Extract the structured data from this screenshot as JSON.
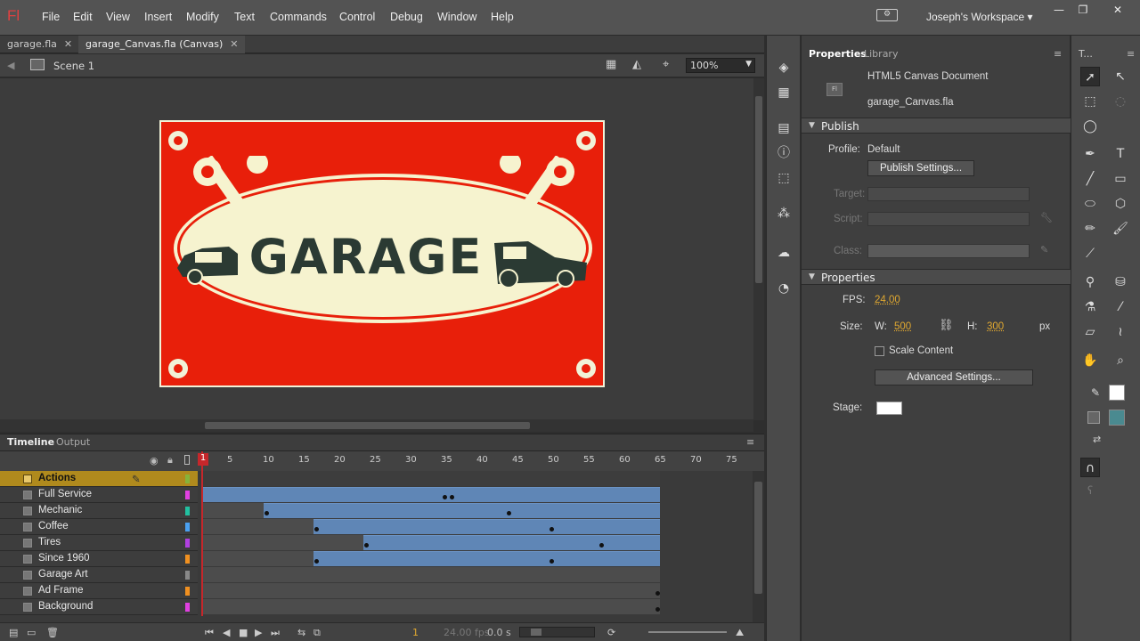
{
  "app": {
    "logo": "Fl"
  },
  "menu": [
    "File",
    "Edit",
    "View",
    "Insert",
    "Modify",
    "Text",
    "Commands",
    "Control",
    "Debug",
    "Window",
    "Help"
  ],
  "workspace": {
    "label": "Joseph's Workspace ▾"
  },
  "window": {
    "minimize": "—",
    "restore": "❐",
    "close": "✕"
  },
  "doc_tabs": [
    {
      "label": "garage.fla",
      "close": "✕"
    },
    {
      "label": "garage_Canvas.fla (Canvas)",
      "close": "✕"
    }
  ],
  "edit_bar": {
    "scene": "Scene 1",
    "zoom": "100%"
  },
  "stage_art": {
    "headline": "GARAGE"
  },
  "timeline": {
    "tabs": [
      "Timeline",
      "Output"
    ],
    "ticks": [
      "1",
      "5",
      "10",
      "15",
      "20",
      "25",
      "30",
      "35",
      "40",
      "45",
      "50",
      "55",
      "60",
      "65",
      "70",
      "75"
    ],
    "playhead": "1",
    "layers": [
      {
        "name": "Actions",
        "color": "#b07a2c"
      },
      {
        "name": "Full Service",
        "color": "#e040e0"
      },
      {
        "name": "Mechanic",
        "color": "#22c0a0"
      },
      {
        "name": "Coffee",
        "color": "#4aa0f0"
      },
      {
        "name": "Tires",
        "color": "#b040e0"
      },
      {
        "name": "Since 1960",
        "color": "#f09020"
      },
      {
        "name": "Garage Art",
        "color": "#888888"
      },
      {
        "name": "Ad Frame",
        "color": "#f09020"
      },
      {
        "name": "Background",
        "color": "#e040e0"
      }
    ],
    "footer": {
      "frame": "1",
      "fps": "24.00 fps",
      "time": "0.0 s"
    }
  },
  "properties": {
    "tabs": [
      "Properties",
      "Library"
    ],
    "doc_type": "HTML5 Canvas Document",
    "file": "garage_Canvas.fla",
    "publish": {
      "title": "Publish",
      "profile_label": "Profile:",
      "profile": "Default",
      "settings_button": "Publish Settings...",
      "target_label": "Target:",
      "script_label": "Script:",
      "class_label": "Class:"
    },
    "props": {
      "title": "Properties",
      "fps_label": "FPS:",
      "fps": "24.00",
      "size_label": "Size:",
      "w_label": "W:",
      "w": "500",
      "h_label": "H:",
      "h": "300",
      "unit": "px",
      "scale_content": "Scale Content",
      "advanced_button": "Advanced Settings...",
      "stage_label": "Stage:",
      "stage_color": "#ffffff"
    }
  },
  "tools": {
    "header": "T..."
  },
  "colors": {
    "sign_red": "#e81f0a",
    "cream": "#f1f2d8",
    "ink": "#2b3a33",
    "tween": "#5f86b6",
    "layer_selected": "#b08a1d"
  }
}
